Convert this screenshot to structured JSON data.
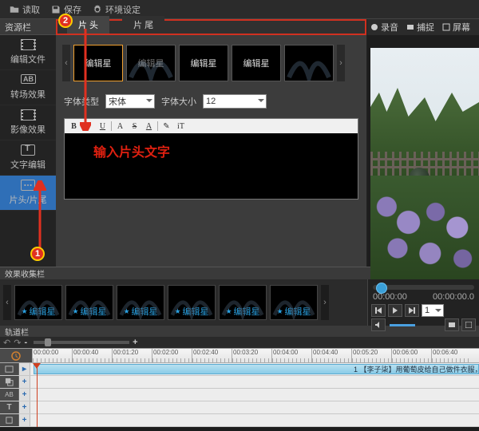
{
  "topbar": {
    "read": "读取",
    "save": "保存",
    "env": "环境设定"
  },
  "sidebar": {
    "title": "资源栏",
    "items": [
      {
        "label": "编辑文件"
      },
      {
        "label": "转场效果"
      },
      {
        "label": "影像效果"
      },
      {
        "label": "文字编辑"
      },
      {
        "label": "片头/片尾"
      }
    ]
  },
  "tabs": {
    "head": "片 头",
    "tail": "片 尾"
  },
  "thumbs": [
    {
      "t": "编辑星"
    },
    {
      "t": "编辑星"
    },
    {
      "t": "编辑星"
    },
    {
      "t": "编辑星"
    },
    {
      "t": ""
    }
  ],
  "font": {
    "type_label": "字体类型",
    "type_value": "宋体",
    "size_label": "字体大小",
    "size_value": "12"
  },
  "toolbar": [
    "B",
    "I",
    "U",
    "A",
    "S",
    "A",
    "✎",
    "iT"
  ],
  "editor_placeholder": "输入片头文字",
  "preview_top": {
    "rec": "录音",
    "cap": "捕捉",
    "full": "屏幕"
  },
  "annotations": {
    "a1": "1",
    "a2": "2"
  },
  "collect": {
    "title": "效果收集栏",
    "items": [
      "编辑星",
      "编辑星",
      "编辑星",
      "编辑星",
      "编辑星",
      "编辑星"
    ]
  },
  "player": {
    "cur": "00:00:00",
    "dur": "00:00:00.0",
    "speed": "1"
  },
  "tracks": {
    "title": "轨道栏",
    "zoom_minus": "-",
    "zoom_plus": "+",
    "times": [
      "00:00:00",
      "00:00:40",
      "00:01:20",
      "00:02:00",
      "00:02:40",
      "00:03:20",
      "00:04:00",
      "00:04:40",
      "00:05:20",
      "00:06:00",
      "00:06:40"
    ],
    "clip_label": "1 【李子柒】用葡萄皮给自己做件衣服，"
  }
}
